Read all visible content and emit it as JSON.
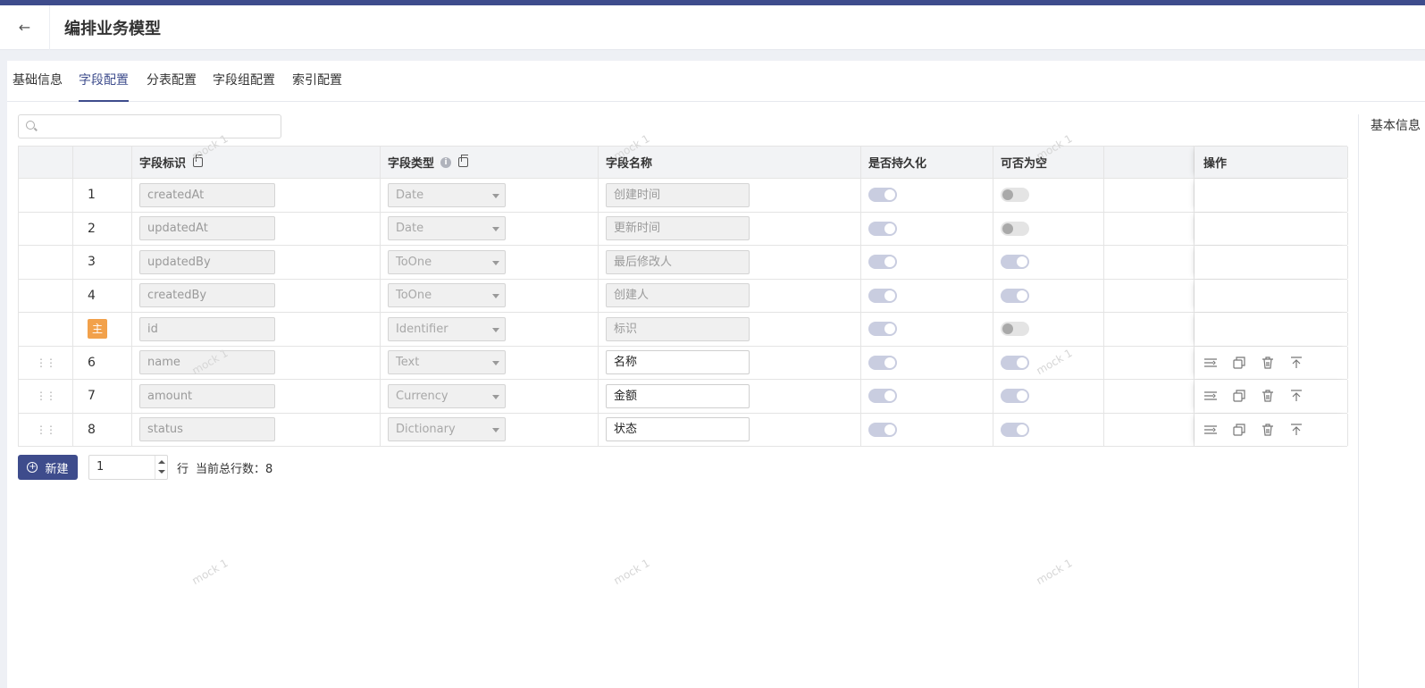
{
  "header": {
    "back_icon": "arrow-left-icon",
    "title": "编排业务模型"
  },
  "tabs": [
    {
      "label": "基础信息",
      "active": false
    },
    {
      "label": "字段配置",
      "active": true
    },
    {
      "label": "分表配置",
      "active": false
    },
    {
      "label": "字段组配置",
      "active": false
    },
    {
      "label": "索引配置",
      "active": false
    }
  ],
  "right_panel": {
    "title": "基本信息"
  },
  "search": {
    "value": "",
    "placeholder": ""
  },
  "columns": {
    "field_id": "字段标识",
    "field_type": "字段类型",
    "field_name": "字段名称",
    "persistent": "是否持久化",
    "nullable": "可否为空",
    "actions": "操作"
  },
  "rows": [
    {
      "index": "1",
      "field_id": "createdAt",
      "type": "Date",
      "name": "创建时间",
      "persistent": true,
      "nullable": false,
      "editable": false,
      "primary": false
    },
    {
      "index": "2",
      "field_id": "updatedAt",
      "type": "Date",
      "name": "更新时间",
      "persistent": true,
      "nullable": false,
      "editable": false,
      "primary": false
    },
    {
      "index": "3",
      "field_id": "updatedBy",
      "type": "ToOne",
      "name": "最后修改人",
      "persistent": true,
      "nullable": true,
      "editable": false,
      "primary": false
    },
    {
      "index": "4",
      "field_id": "createdBy",
      "type": "ToOne",
      "name": "创建人",
      "persistent": true,
      "nullable": true,
      "editable": false,
      "primary": false
    },
    {
      "index": "主",
      "field_id": "id",
      "type": "Identifier",
      "name": "标识",
      "persistent": true,
      "nullable": false,
      "editable": false,
      "primary": true
    },
    {
      "index": "6",
      "field_id": "name",
      "type": "Text",
      "name": "名称",
      "persistent": true,
      "nullable": true,
      "editable": true,
      "primary": false
    },
    {
      "index": "7",
      "field_id": "amount",
      "type": "Currency",
      "name": "金额",
      "persistent": true,
      "nullable": true,
      "editable": true,
      "primary": false
    },
    {
      "index": "8",
      "field_id": "status",
      "type": "Dictionary",
      "name": "状态",
      "persistent": true,
      "nullable": true,
      "editable": true,
      "primary": false
    }
  ],
  "footer": {
    "new_label": "新建",
    "count_value": "1",
    "row_unit": "行",
    "total_label": "当前总行数：",
    "total_value": "8"
  },
  "watermark": "mock 1",
  "colors": {
    "primary": "#3e4c8c",
    "primary_key_badge": "#f2a14b"
  }
}
